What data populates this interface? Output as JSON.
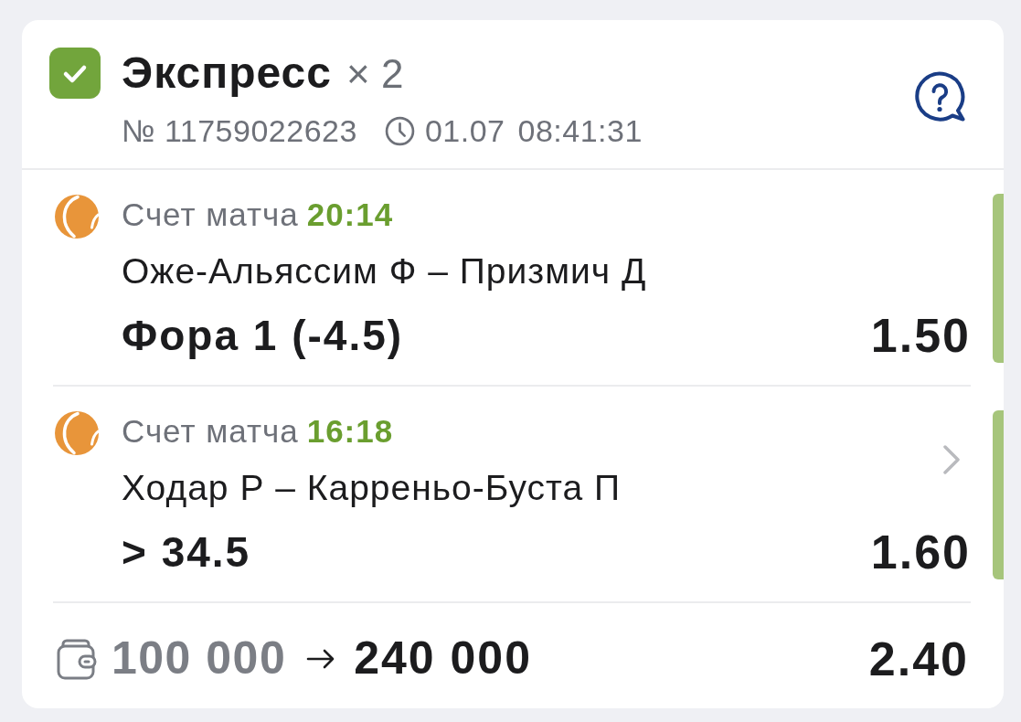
{
  "bet": {
    "won": true,
    "title": "Экспресс",
    "multiplier": "× 2",
    "number": "№ 11759022623",
    "date": "01.07",
    "time": "08:41:31"
  },
  "events": [
    {
      "label": "Счет матча",
      "score": "20:14",
      "match": "Оже-Альяссим Ф – Призмич Д",
      "selection": "Фора 1 (-4.5)",
      "odds": "1.50",
      "won": true,
      "expandable": false
    },
    {
      "label": "Счет матча",
      "score": "16:18",
      "match": "Ходар Р – Карреньо-Буста П",
      "selection": "> 34.5",
      "odds": "1.60",
      "won": true,
      "expandable": true
    }
  ],
  "summary": {
    "stake": "100 000",
    "payout": "240 000",
    "total_odds": "2.40"
  }
}
